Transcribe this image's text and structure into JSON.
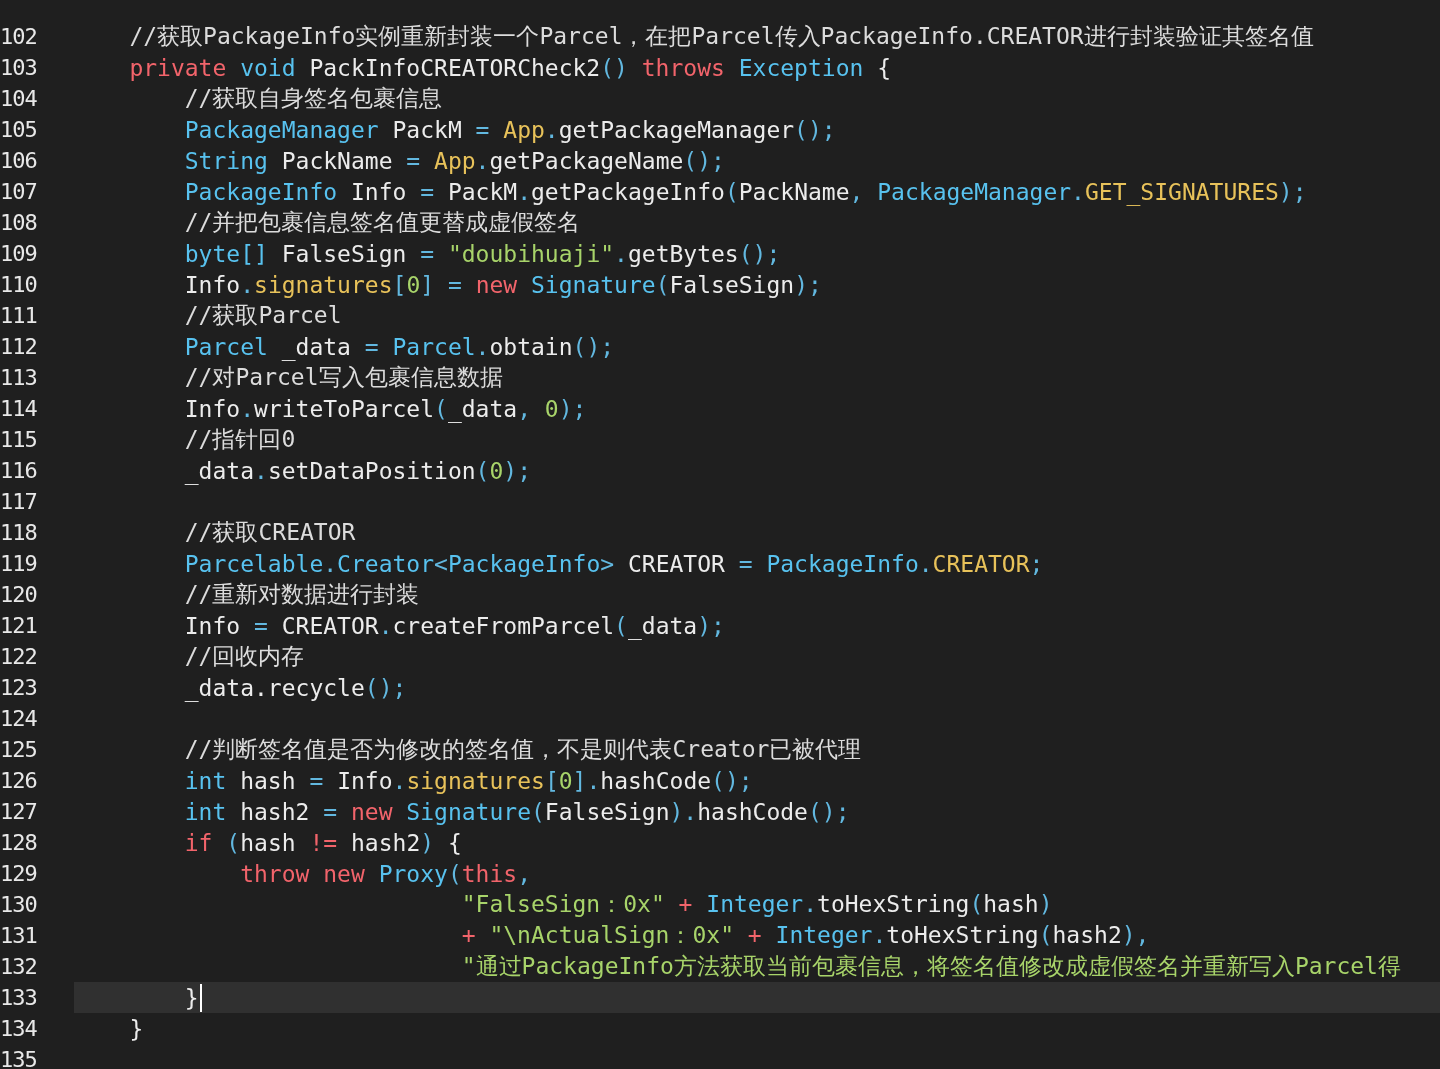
{
  "editor": {
    "lines": [
      {
        "number": "102",
        "current": false,
        "tokens": [
          {
            "kind": "comment",
            "text": "    //获取PackageInfo实例重新封装一个Parcel，在把Parcel传入PackageInfo.CREATOR进行封装验证其签名值"
          }
        ]
      },
      {
        "number": "103",
        "current": false,
        "tokens": [
          {
            "kind": "keyword",
            "text": "    private"
          },
          {
            "kind": "type",
            "text": " void"
          },
          {
            "kind": "plain",
            "text": " PackInfoCREATORCheck2"
          },
          {
            "kind": "punct",
            "text": "()"
          },
          {
            "kind": "keyword",
            "text": " throws"
          },
          {
            "kind": "type",
            "text": " Exception"
          },
          {
            "kind": "plain",
            "text": " {"
          }
        ]
      },
      {
        "number": "104",
        "current": false,
        "tokens": [
          {
            "kind": "comment",
            "text": "        //获取自身签名包裹信息"
          }
        ]
      },
      {
        "number": "105",
        "current": false,
        "tokens": [
          {
            "kind": "type",
            "text": "        PackageManager"
          },
          {
            "kind": "plain",
            "text": " PackM "
          },
          {
            "kind": "punct",
            "text": "="
          },
          {
            "kind": "member",
            "text": " App"
          },
          {
            "kind": "punct",
            "text": "."
          },
          {
            "kind": "plain",
            "text": "getPackageManager"
          },
          {
            "kind": "punct",
            "text": "();"
          }
        ]
      },
      {
        "number": "106",
        "current": false,
        "tokens": [
          {
            "kind": "type",
            "text": "        String"
          },
          {
            "kind": "plain",
            "text": " PackName "
          },
          {
            "kind": "punct",
            "text": "="
          },
          {
            "kind": "member",
            "text": " App"
          },
          {
            "kind": "punct",
            "text": "."
          },
          {
            "kind": "plain",
            "text": "getPackageName"
          },
          {
            "kind": "punct",
            "text": "();"
          }
        ]
      },
      {
        "number": "107",
        "current": false,
        "tokens": [
          {
            "kind": "type",
            "text": "        PackageInfo"
          },
          {
            "kind": "plain",
            "text": " Info "
          },
          {
            "kind": "punct",
            "text": "="
          },
          {
            "kind": "plain",
            "text": " PackM"
          },
          {
            "kind": "punct",
            "text": "."
          },
          {
            "kind": "plain",
            "text": "getPackageInfo"
          },
          {
            "kind": "punct",
            "text": "("
          },
          {
            "kind": "plain",
            "text": "PackName"
          },
          {
            "kind": "punct",
            "text": ","
          },
          {
            "kind": "type",
            "text": " PackageManager"
          },
          {
            "kind": "punct",
            "text": "."
          },
          {
            "kind": "member",
            "text": "GET_SIGNATURES"
          },
          {
            "kind": "punct",
            "text": ");"
          }
        ]
      },
      {
        "number": "108",
        "current": false,
        "tokens": [
          {
            "kind": "comment",
            "text": "        //并把包裹信息签名值更替成虚假签名"
          }
        ]
      },
      {
        "number": "109",
        "current": false,
        "tokens": [
          {
            "kind": "type",
            "text": "        byte[]"
          },
          {
            "kind": "plain",
            "text": " FalseSign "
          },
          {
            "kind": "punct",
            "text": "="
          },
          {
            "kind": "string",
            "text": " \"doubihuaji\""
          },
          {
            "kind": "punct",
            "text": "."
          },
          {
            "kind": "plain",
            "text": "getBytes"
          },
          {
            "kind": "punct",
            "text": "();"
          }
        ]
      },
      {
        "number": "110",
        "current": false,
        "tokens": [
          {
            "kind": "plain",
            "text": "        Info"
          },
          {
            "kind": "punct",
            "text": "."
          },
          {
            "kind": "member",
            "text": "signatures"
          },
          {
            "kind": "punct",
            "text": "["
          },
          {
            "kind": "number",
            "text": "0"
          },
          {
            "kind": "punct",
            "text": "] ="
          },
          {
            "kind": "keyword",
            "text": " new"
          },
          {
            "kind": "type",
            "text": " Signature"
          },
          {
            "kind": "punct",
            "text": "("
          },
          {
            "kind": "plain",
            "text": "FalseSign"
          },
          {
            "kind": "punct",
            "text": ");"
          }
        ]
      },
      {
        "number": "111",
        "current": false,
        "tokens": [
          {
            "kind": "comment",
            "text": "        //获取Parcel"
          }
        ]
      },
      {
        "number": "112",
        "current": false,
        "tokens": [
          {
            "kind": "type",
            "text": "        Parcel"
          },
          {
            "kind": "plain",
            "text": " _data "
          },
          {
            "kind": "punct",
            "text": "="
          },
          {
            "kind": "type",
            "text": " Parcel"
          },
          {
            "kind": "punct",
            "text": "."
          },
          {
            "kind": "plain",
            "text": "obtain"
          },
          {
            "kind": "punct",
            "text": "();"
          }
        ]
      },
      {
        "number": "113",
        "current": false,
        "tokens": [
          {
            "kind": "comment",
            "text": "        //对Parcel写入包裹信息数据"
          }
        ]
      },
      {
        "number": "114",
        "current": false,
        "tokens": [
          {
            "kind": "plain",
            "text": "        Info"
          },
          {
            "kind": "punct",
            "text": "."
          },
          {
            "kind": "plain",
            "text": "writeToParcel"
          },
          {
            "kind": "punct",
            "text": "("
          },
          {
            "kind": "plain",
            "text": "_data"
          },
          {
            "kind": "punct",
            "text": ","
          },
          {
            "kind": "number",
            "text": " 0"
          },
          {
            "kind": "punct",
            "text": ");"
          }
        ]
      },
      {
        "number": "115",
        "current": false,
        "tokens": [
          {
            "kind": "comment",
            "text": "        //指针回0"
          }
        ]
      },
      {
        "number": "116",
        "current": false,
        "tokens": [
          {
            "kind": "plain",
            "text": "        _data"
          },
          {
            "kind": "punct",
            "text": "."
          },
          {
            "kind": "plain",
            "text": "setDataPosition"
          },
          {
            "kind": "punct",
            "text": "("
          },
          {
            "kind": "number",
            "text": "0"
          },
          {
            "kind": "punct",
            "text": ");"
          }
        ]
      },
      {
        "number": "117",
        "current": false
      },
      {
        "number": "118",
        "current": false,
        "tokens": [
          {
            "kind": "comment",
            "text": "        //获取CREATOR"
          }
        ]
      },
      {
        "number": "119",
        "current": false,
        "tokens": [
          {
            "kind": "type",
            "text": "        Parcelable"
          },
          {
            "kind": "punct",
            "text": "."
          },
          {
            "kind": "type",
            "text": "Creator"
          },
          {
            "kind": "punct",
            "text": "<"
          },
          {
            "kind": "type",
            "text": "PackageInfo"
          },
          {
            "kind": "punct",
            "text": ">"
          },
          {
            "kind": "plain",
            "text": " CREATOR "
          },
          {
            "kind": "punct",
            "text": "="
          },
          {
            "kind": "type",
            "text": " PackageInfo"
          },
          {
            "kind": "punct",
            "text": "."
          },
          {
            "kind": "member",
            "text": "CREATOR"
          },
          {
            "kind": "punct",
            "text": ";"
          }
        ]
      },
      {
        "number": "120",
        "current": false,
        "tokens": [
          {
            "kind": "comment",
            "text": "        //重新对数据进行封装"
          }
        ]
      },
      {
        "number": "121",
        "current": false,
        "tokens": [
          {
            "kind": "plain",
            "text": "        Info "
          },
          {
            "kind": "punct",
            "text": "="
          },
          {
            "kind": "plain",
            "text": " CREATOR"
          },
          {
            "kind": "punct",
            "text": "."
          },
          {
            "kind": "plain",
            "text": "createFromParcel"
          },
          {
            "kind": "punct",
            "text": "("
          },
          {
            "kind": "plain",
            "text": "_data"
          },
          {
            "kind": "punct",
            "text": ");"
          }
        ]
      },
      {
        "number": "122",
        "current": false,
        "tokens": [
          {
            "kind": "comment",
            "text": "        //回收内存"
          }
        ]
      },
      {
        "number": "123",
        "current": false,
        "tokens": [
          {
            "kind": "plain",
            "text": "        _data.recycle"
          },
          {
            "kind": "punct",
            "text": "();"
          }
        ]
      },
      {
        "number": "124",
        "current": false
      },
      {
        "number": "125",
        "current": false,
        "tokens": [
          {
            "kind": "comment",
            "text": "        //判断签名值是否为修改的签名值，不是则代表Creator已被代理"
          }
        ]
      },
      {
        "number": "126",
        "current": false,
        "tokens": [
          {
            "kind": "type",
            "text": "        int"
          },
          {
            "kind": "plain",
            "text": " hash "
          },
          {
            "kind": "punct",
            "text": "="
          },
          {
            "kind": "plain",
            "text": " Info"
          },
          {
            "kind": "punct",
            "text": "."
          },
          {
            "kind": "member",
            "text": "signatures"
          },
          {
            "kind": "punct",
            "text": "["
          },
          {
            "kind": "number",
            "text": "0"
          },
          {
            "kind": "punct",
            "text": "]."
          },
          {
            "kind": "plain",
            "text": "hashCode"
          },
          {
            "kind": "punct",
            "text": "();"
          }
        ]
      },
      {
        "number": "127",
        "current": false,
        "tokens": [
          {
            "kind": "type",
            "text": "        int"
          },
          {
            "kind": "plain",
            "text": " hash2 "
          },
          {
            "kind": "punct",
            "text": "="
          },
          {
            "kind": "keyword",
            "text": " new"
          },
          {
            "kind": "type",
            "text": " Signature"
          },
          {
            "kind": "punct",
            "text": "("
          },
          {
            "kind": "plain",
            "text": "FalseSign"
          },
          {
            "kind": "punct",
            "text": ")."
          },
          {
            "kind": "plain",
            "text": "hashCode"
          },
          {
            "kind": "punct",
            "text": "();"
          }
        ]
      },
      {
        "number": "128",
        "current": false,
        "tokens": [
          {
            "kind": "keyword",
            "text": "        if"
          },
          {
            "kind": "punct",
            "text": " ("
          },
          {
            "kind": "plain",
            "text": "hash "
          },
          {
            "kind": "operator",
            "text": "!="
          },
          {
            "kind": "plain",
            "text": " hash2"
          },
          {
            "kind": "punct",
            "text": ")"
          },
          {
            "kind": "plain",
            "text": " {"
          }
        ]
      },
      {
        "number": "129",
        "current": false,
        "tokens": [
          {
            "kind": "keyword",
            "text": "            throw new"
          },
          {
            "kind": "type",
            "text": " Proxy"
          },
          {
            "kind": "punct",
            "text": "("
          },
          {
            "kind": "keyword",
            "text": "this"
          },
          {
            "kind": "punct",
            "text": ","
          }
        ]
      },
      {
        "number": "130",
        "current": false,
        "tokens": [
          {
            "kind": "string",
            "text": "                            \"FalseSign：0x\""
          },
          {
            "kind": "operator",
            "text": " +"
          },
          {
            "kind": "type",
            "text": " Integer"
          },
          {
            "kind": "punct",
            "text": "."
          },
          {
            "kind": "plain",
            "text": "toHexString"
          },
          {
            "kind": "punct",
            "text": "("
          },
          {
            "kind": "plain",
            "text": "hash"
          },
          {
            "kind": "punct",
            "text": ")"
          }
        ]
      },
      {
        "number": "131",
        "current": false,
        "tokens": [
          {
            "kind": "operator",
            "text": "                            +"
          },
          {
            "kind": "string",
            "text": " \"\\nActualSign：0x\""
          },
          {
            "kind": "operator",
            "text": " +"
          },
          {
            "kind": "type",
            "text": " Integer"
          },
          {
            "kind": "punct",
            "text": "."
          },
          {
            "kind": "plain",
            "text": "toHexString"
          },
          {
            "kind": "punct",
            "text": "("
          },
          {
            "kind": "plain",
            "text": "hash2"
          },
          {
            "kind": "punct",
            "text": "),"
          }
        ]
      },
      {
        "number": "132",
        "current": false,
        "tokens": [
          {
            "kind": "string",
            "text": "                            \"通过PackageInfo方法获取当前包裹信息，将签名值修改成虚假签名并重新写入Parcel得"
          }
        ]
      },
      {
        "number": "133",
        "current": true,
        "tokens": [
          {
            "kind": "plain",
            "text": "        }"
          }
        ]
      },
      {
        "number": "134",
        "current": false,
        "tokens": [
          {
            "kind": "plain",
            "text": "    }"
          }
        ]
      },
      {
        "number": "135",
        "current": false
      }
    ]
  }
}
